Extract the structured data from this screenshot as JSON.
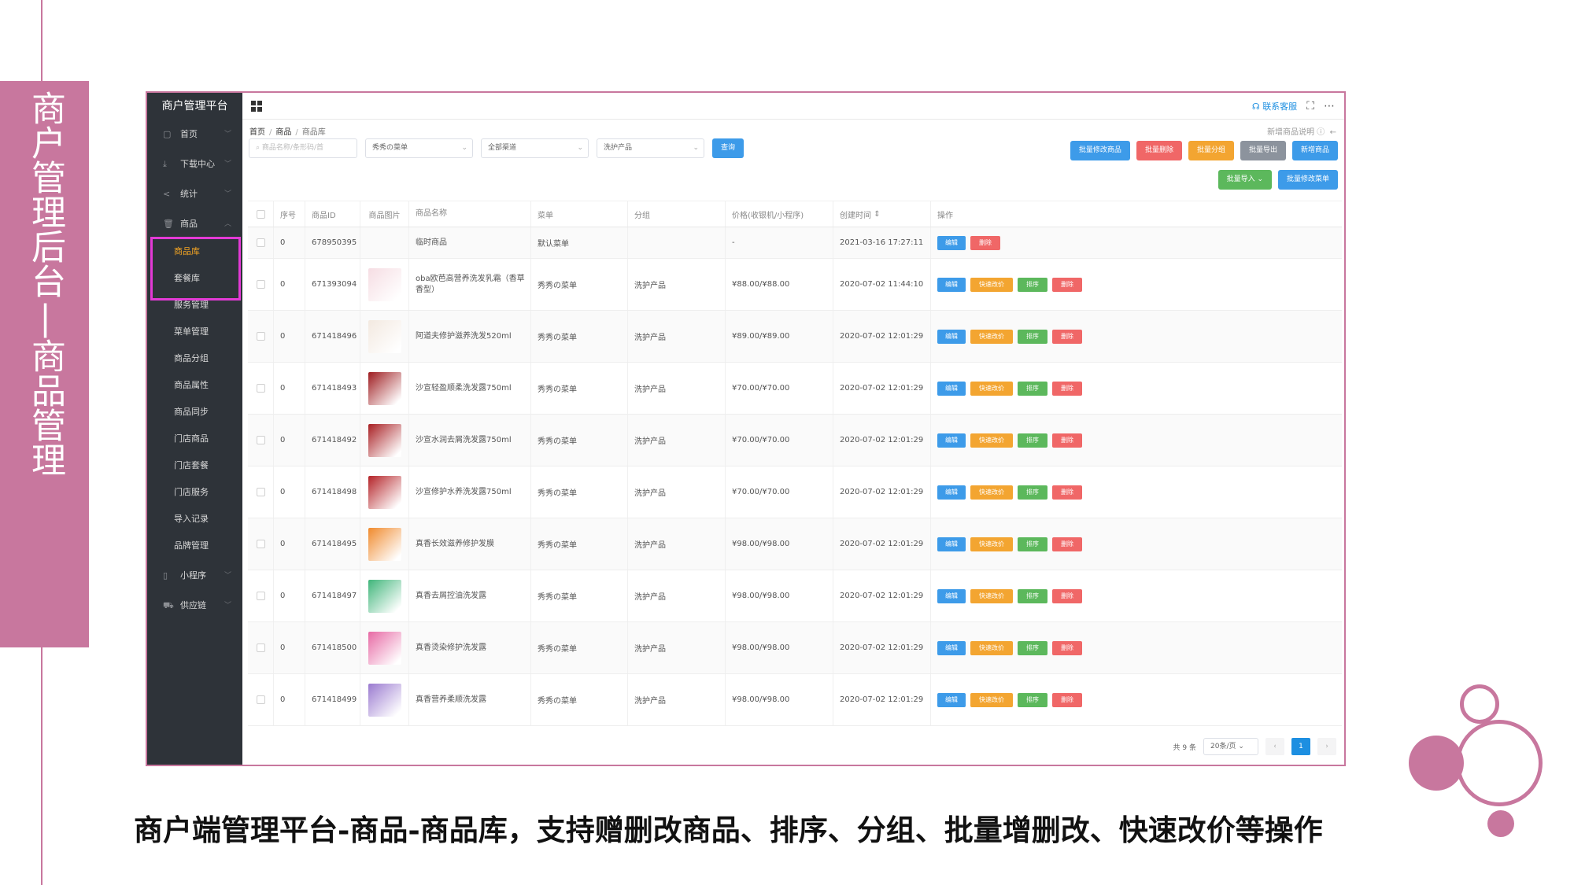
{
  "slide": {
    "banner_title": "商户管理后台|商品管理",
    "caption": "商户端管理平台-商品-商品库，支持赠删改商品、排序、分组、批量增删改、快速改价等操作"
  },
  "app": {
    "brand": "商户管理平台",
    "contact": "联系客服"
  },
  "sidebar": {
    "items": [
      {
        "label": "首页",
        "icon": "page-icon"
      },
      {
        "label": "下载中心",
        "icon": "download-icon"
      },
      {
        "label": "统计",
        "icon": "share-icon"
      },
      {
        "label": "商品",
        "icon": "trash-icon"
      }
    ],
    "sub_items": [
      "商品库",
      "套餐库",
      "服务管理",
      "菜单管理",
      "商品分组",
      "商品属性",
      "商品同步",
      "门店商品",
      "门店套餐",
      "门店服务",
      "导入记录",
      "品牌管理"
    ],
    "bottom_items": [
      {
        "label": "小程序",
        "icon": "mobile-icon"
      },
      {
        "label": "供应链",
        "icon": "truck-icon"
      }
    ]
  },
  "breadcrumb": [
    "首页",
    "商品",
    "商品库"
  ],
  "help_text": "新增商品说明",
  "filters": {
    "search_placeholder": "商品名称/条形码/首",
    "menu_select": "秀秀の菜单",
    "channel_select": "全部渠道",
    "category_select": "洗护产品",
    "query_button": "查询"
  },
  "toolbar": {
    "row1": [
      "批量修改商品",
      "批量删除",
      "批量分组",
      "批量导出",
      "新增商品"
    ],
    "row2": [
      "批量导入",
      "批量修改菜单"
    ]
  },
  "table": {
    "headers": [
      "序号",
      "商品ID",
      "商品图片",
      "商品名称",
      "菜单",
      "分组",
      "价格(收银机/小程序)",
      "创建时间",
      "操作"
    ],
    "rows": [
      {
        "no": "0",
        "id": "678950395",
        "name": "临时商品",
        "menu": "默认菜单",
        "group": "",
        "price": "-",
        "time": "2021-03-16 17:27:11",
        "ops": [
          "编辑",
          "删除"
        ]
      },
      {
        "no": "0",
        "id": "671393094",
        "name": "oba欧芭高营养洗发乳霜（香草香型）",
        "menu": "秀秀の菜单",
        "group": "洗护产品",
        "price": "¥88.00/¥88.00",
        "time": "2020-07-02 11:44:10",
        "ops": [
          "编辑",
          "快速改价",
          "排序",
          "删除"
        ]
      },
      {
        "no": "0",
        "id": "671418496",
        "name": "阿道夫修护滋养洗发520ml",
        "menu": "秀秀の菜单",
        "group": "洗护产品",
        "price": "¥89.00/¥89.00",
        "time": "2020-07-02 12:01:29",
        "ops": [
          "编辑",
          "快速改价",
          "排序",
          "删除"
        ]
      },
      {
        "no": "0",
        "id": "671418493",
        "name": "沙宣轻盈顺柔洗发露750ml",
        "menu": "秀秀の菜单",
        "group": "洗护产品",
        "price": "¥70.00/¥70.00",
        "time": "2020-07-02 12:01:29",
        "ops": [
          "编辑",
          "快速改价",
          "排序",
          "删除"
        ]
      },
      {
        "no": "0",
        "id": "671418492",
        "name": "沙宣水润去屑洗发露750ml",
        "menu": "秀秀の菜单",
        "group": "洗护产品",
        "price": "¥70.00/¥70.00",
        "time": "2020-07-02 12:01:29",
        "ops": [
          "编辑",
          "快速改价",
          "排序",
          "删除"
        ]
      },
      {
        "no": "0",
        "id": "671418498",
        "name": "沙宣修护水养洗发露750ml",
        "menu": "秀秀の菜单",
        "group": "洗护产品",
        "price": "¥70.00/¥70.00",
        "time": "2020-07-02 12:01:29",
        "ops": [
          "编辑",
          "快速改价",
          "排序",
          "删除"
        ]
      },
      {
        "no": "0",
        "id": "671418495",
        "name": "真香长效滋养修护发膜",
        "menu": "秀秀の菜单",
        "group": "洗护产品",
        "price": "¥98.00/¥98.00",
        "time": "2020-07-02 12:01:29",
        "ops": [
          "编辑",
          "快速改价",
          "排序",
          "删除"
        ]
      },
      {
        "no": "0",
        "id": "671418497",
        "name": "真香去屑控油洗发露",
        "menu": "秀秀の菜单",
        "group": "洗护产品",
        "price": "¥98.00/¥98.00",
        "time": "2020-07-02 12:01:29",
        "ops": [
          "编辑",
          "快速改价",
          "排序",
          "删除"
        ]
      },
      {
        "no": "0",
        "id": "671418500",
        "name": "真香烫染修护洗发露",
        "menu": "秀秀の菜单",
        "group": "洗护产品",
        "price": "¥98.00/¥98.00",
        "time": "2020-07-02 12:01:29",
        "ops": [
          "编辑",
          "快速改价",
          "排序",
          "删除"
        ]
      },
      {
        "no": "0",
        "id": "671418499",
        "name": "真香营养柔顺洗发露",
        "menu": "秀秀の菜单",
        "group": "洗护产品",
        "price": "¥98.00/¥98.00",
        "time": "2020-07-02 12:01:29",
        "ops": [
          "编辑",
          "快速改价",
          "排序",
          "删除"
        ]
      }
    ],
    "thumb_colors": [
      "",
      "#f6dde3",
      "#f3e9e0",
      "#9e1b1f",
      "#a81e22",
      "#b42227",
      "#f08a2c",
      "#3fb57a",
      "#e769a4",
      "#9a7ad0"
    ]
  },
  "pagination": {
    "total": "共 9 条",
    "page_size": "20条/页",
    "current": "1"
  },
  "colors": {
    "accent_pink": "#c8779e",
    "primary_blue": "#3d9be9",
    "danger_red": "#f06767",
    "warning_orange": "#f3a531",
    "success_green": "#5cb85c",
    "sidebar_bg": "#2e3339",
    "highlight_magenta": "#e33ad6"
  }
}
